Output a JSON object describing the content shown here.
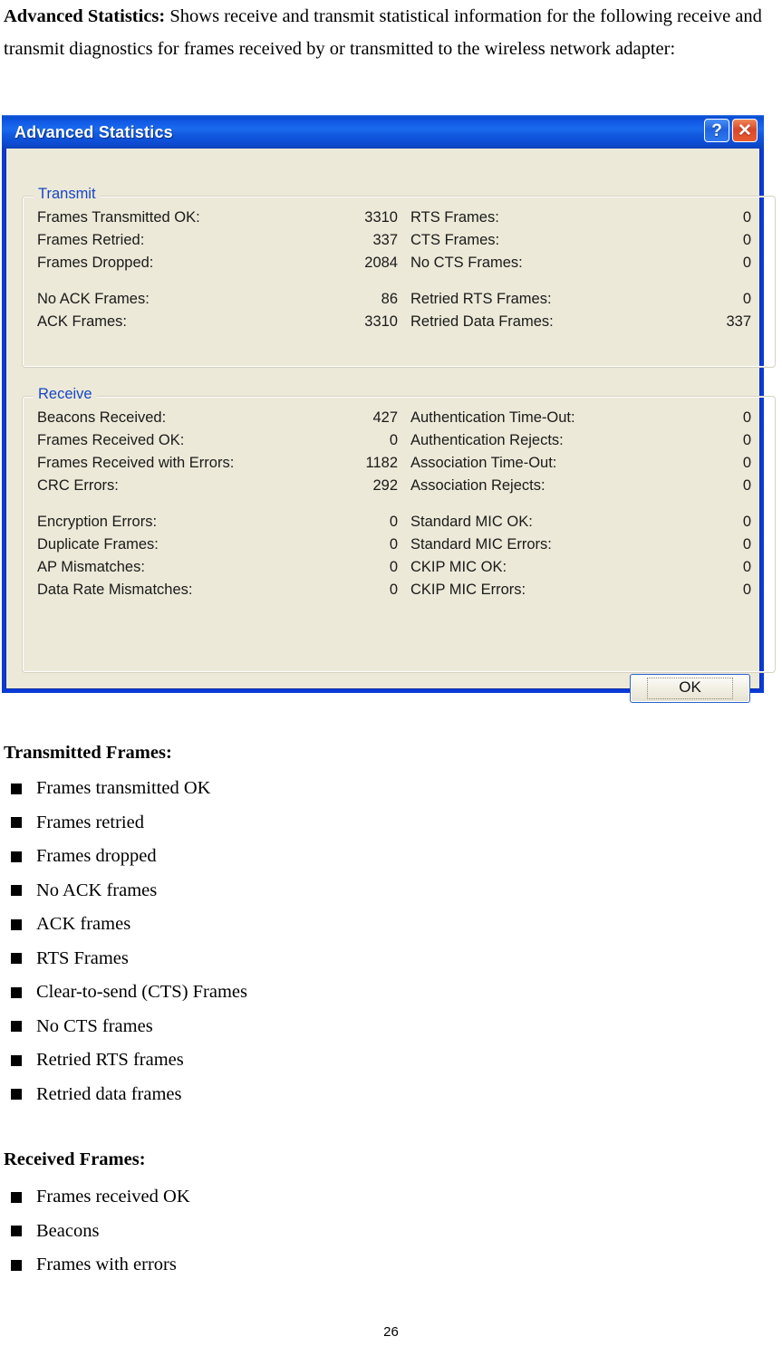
{
  "intro": {
    "bold_lead": "Advanced Statistics:",
    "body": " Shows receive and transmit statistical information for the following receive and transmit diagnostics for frames received by or transmitted to the wireless network adapter:"
  },
  "dialog": {
    "title": "Advanced Statistics",
    "help_button": "?",
    "close_button": "✕",
    "ok_button": "OK",
    "transmit": {
      "legend": "Transmit",
      "left_column": [
        {
          "label": "Frames Transmitted OK:",
          "value": "3310"
        },
        {
          "label": "Frames Retried:",
          "value": "337"
        },
        {
          "label": "Frames Dropped:",
          "value": "2084"
        },
        {
          "label": "No ACK Frames:",
          "value": "86"
        },
        {
          "label": "ACK Frames:",
          "value": "3310"
        }
      ],
      "right_column": [
        {
          "label": "RTS Frames:",
          "value": "0"
        },
        {
          "label": "CTS Frames:",
          "value": "0"
        },
        {
          "label": "No CTS Frames:",
          "value": "0"
        },
        {
          "label": "Retried RTS Frames:",
          "value": "0"
        },
        {
          "label": "Retried Data Frames:",
          "value": "337"
        }
      ]
    },
    "receive": {
      "legend": "Receive",
      "left_column": [
        {
          "label": "Beacons Received:",
          "value": "427"
        },
        {
          "label": "Frames Received OK:",
          "value": "0"
        },
        {
          "label": "Frames Received with Errors:",
          "value": "1182"
        },
        {
          "label": "CRC Errors:",
          "value": "292"
        },
        {
          "label": "Encryption Errors:",
          "value": "0"
        },
        {
          "label": "Duplicate Frames:",
          "value": "0"
        },
        {
          "label": "AP Mismatches:",
          "value": "0"
        },
        {
          "label": "Data Rate Mismatches:",
          "value": "0"
        }
      ],
      "right_column": [
        {
          "label": "Authentication Time-Out:",
          "value": "0"
        },
        {
          "label": "Authentication Rejects:",
          "value": "0"
        },
        {
          "label": "Association Time-Out:",
          "value": "0"
        },
        {
          "label": "Association Rejects:",
          "value": "0"
        },
        {
          "label": "Standard MIC OK:",
          "value": "0"
        },
        {
          "label": "Standard MIC Errors:",
          "value": "0"
        },
        {
          "label": "CKIP MIC OK:",
          "value": "0"
        },
        {
          "label": "CKIP MIC Errors:",
          "value": "0"
        }
      ]
    }
  },
  "transmitted_frames": {
    "heading": "Transmitted Frames:",
    "items": [
      "Frames transmitted OK",
      "Frames retried",
      "Frames dropped",
      "No ACK frames",
      "ACK frames",
      "RTS Frames",
      "Clear-to-send (CTS) Frames",
      "No CTS frames",
      "Retried RTS frames",
      "Retried data frames"
    ]
  },
  "received_frames": {
    "heading": "Received Frames:",
    "items": [
      "Frames received OK",
      "Beacons",
      "Frames with errors"
    ]
  },
  "footer": {
    "page_number": "26"
  },
  "colors": {
    "titlebar_blue": "#1159e0",
    "dialog_face": "#ece9d8",
    "legend_blue": "#1745c4",
    "close_red": "#d9472a"
  }
}
